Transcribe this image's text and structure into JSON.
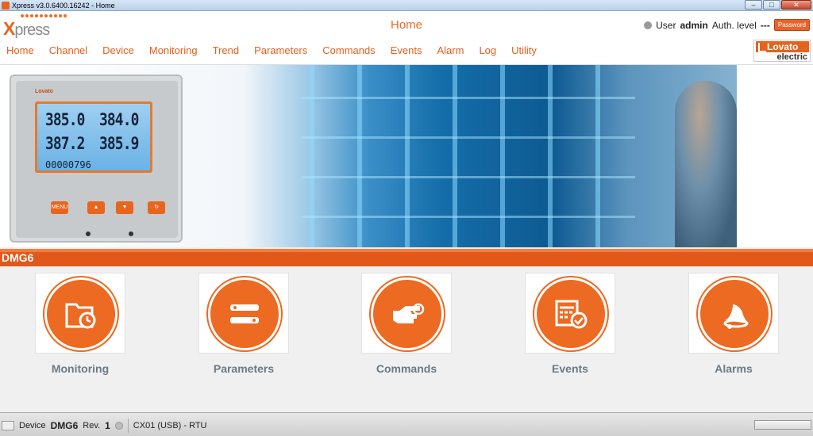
{
  "window": {
    "title": "Xpress v3.0.6400.16242 - Home",
    "min": "–",
    "max": "□",
    "close": "✕"
  },
  "header": {
    "logo_x": "X",
    "logo_rest": "press",
    "page_title": "Home",
    "user_label": "User",
    "user_name": "admin",
    "auth_label": "Auth. level",
    "auth_value": "---",
    "password_button": "Password"
  },
  "nav": {
    "items": [
      "Home",
      "Channel",
      "Device",
      "Monitoring",
      "Trend",
      "Parameters",
      "Commands",
      "Events",
      "Alarm",
      "Log",
      "Utility"
    ]
  },
  "brand": {
    "line1": "Lovato",
    "line2": "electric"
  },
  "meter": {
    "brand": "Lovato",
    "r1a": "385.0",
    "r1b": "384.0",
    "r2a": "387.2",
    "r2b": "385.9",
    "counter": "00000796",
    "menu_button": "MENU"
  },
  "section": {
    "title": "DMG6"
  },
  "tiles": [
    {
      "label": "Monitoring",
      "icon": "monitoring-icon"
    },
    {
      "label": "Parameters",
      "icon": "tools-icon"
    },
    {
      "label": "Commands",
      "icon": "pointing-hand-icon"
    },
    {
      "label": "Events",
      "icon": "calendar-check-icon"
    },
    {
      "label": "Alarms",
      "icon": "bell-icon"
    }
  ],
  "statusbar": {
    "device_label": "Device",
    "device_value": "DMG6",
    "rev_label": "Rev.",
    "rev_value": "1",
    "connection": "CX01 (USB) - RTU"
  },
  "colors": {
    "accent": "#e2581a",
    "nav_text": "#e4601d",
    "tile_label": "#6c7a86"
  }
}
